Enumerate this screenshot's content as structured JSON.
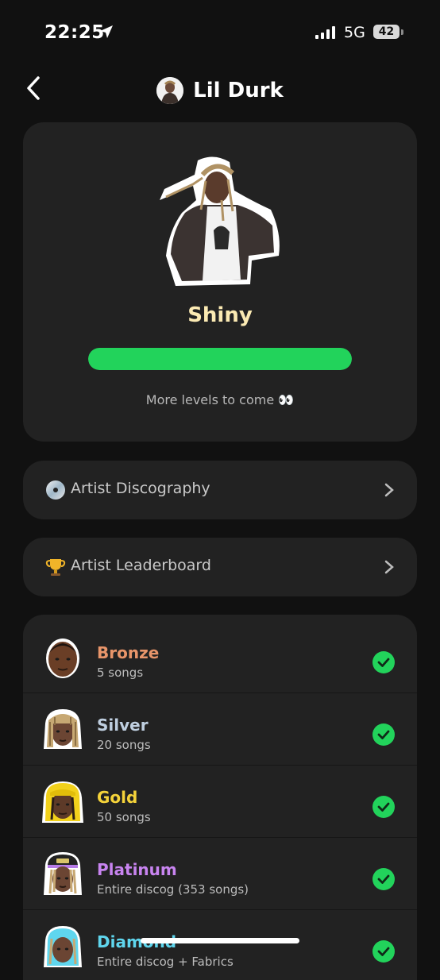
{
  "status_bar": {
    "time": "22:25",
    "network": "5G",
    "battery": "42"
  },
  "header": {
    "title": "Lil Durk"
  },
  "hero": {
    "level_name": "Shiny",
    "progress_percent": 100,
    "more_text": "More levels to come 👀"
  },
  "links": [
    {
      "label": "Artist Discography",
      "icon": "cd-icon"
    },
    {
      "label": "Artist Leaderboard",
      "icon": "trophy-icon"
    }
  ],
  "levels": [
    {
      "name": "Bronze",
      "subtitle": "5 songs",
      "color": "#e8956a",
      "completed": true
    },
    {
      "name": "Silver",
      "subtitle": "20 songs",
      "color": "#bfcfe0",
      "completed": true
    },
    {
      "name": "Gold",
      "subtitle": "50 songs",
      "color": "#f5d33a",
      "completed": true
    },
    {
      "name": "Platinum",
      "subtitle": "Entire discog (353 songs)",
      "color": "#c884f0",
      "completed": true
    },
    {
      "name": "Diamond",
      "subtitle": "Entire discog + Fabrics",
      "color": "#5fd6ee",
      "completed": true
    }
  ],
  "colors": {
    "accent_green": "#22d35b",
    "card_bg": "#222222",
    "page_bg": "#111111"
  }
}
